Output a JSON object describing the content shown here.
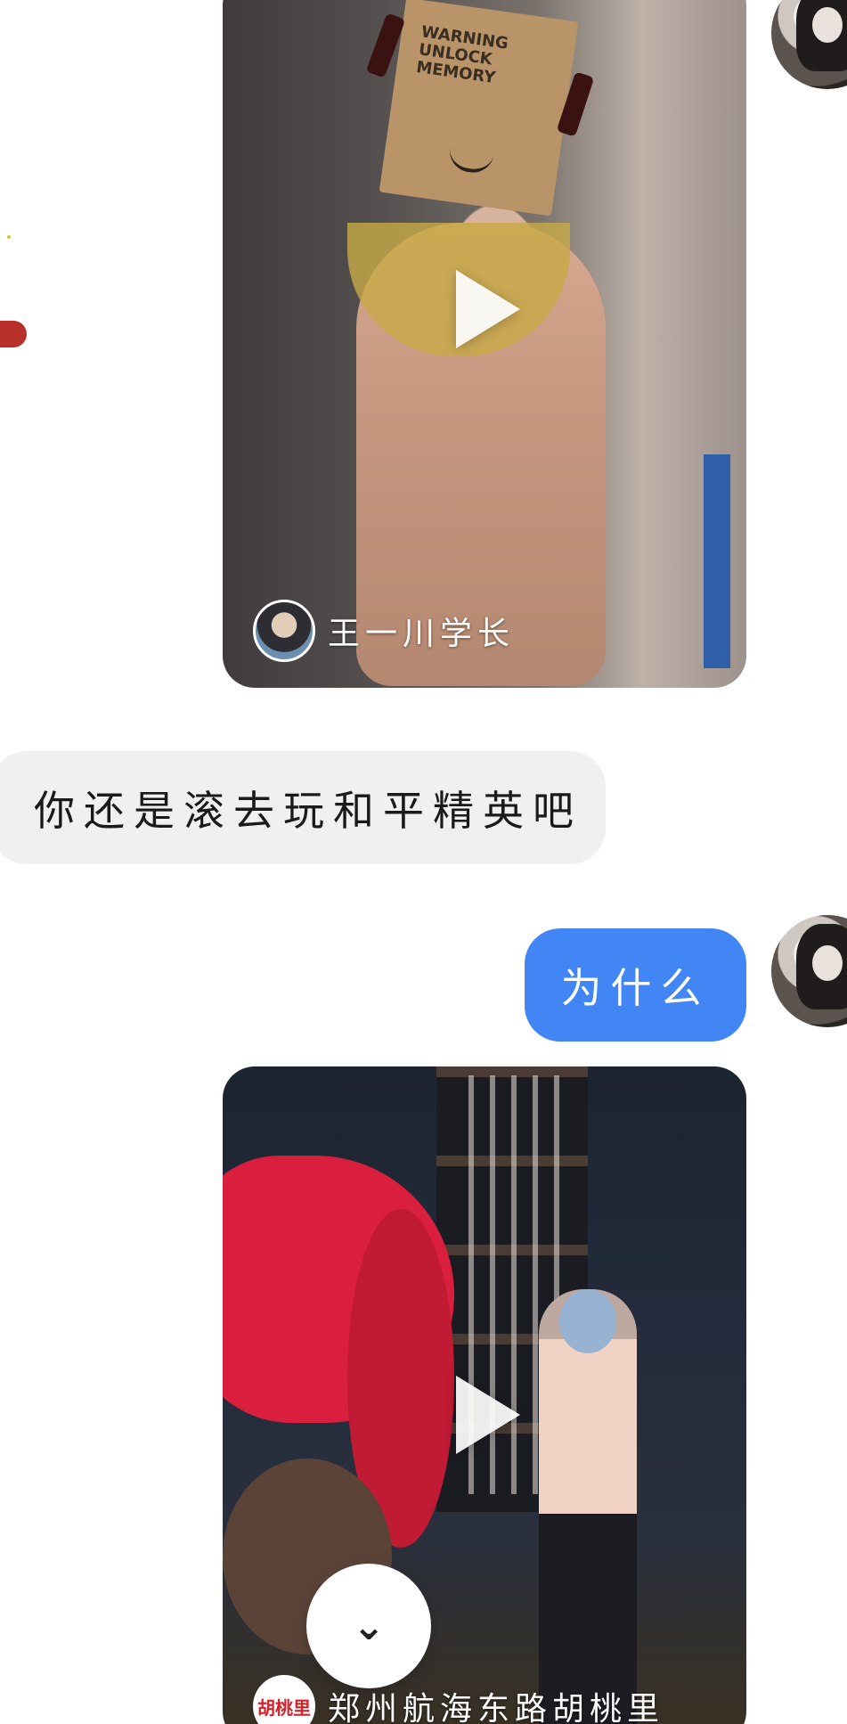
{
  "messages": [
    {
      "type": "video",
      "direction": "outgoing",
      "author_name": "王一川学长",
      "sticker_text": "WARNING\nUNLOCK\nMEMORY"
    },
    {
      "type": "text",
      "direction": "incoming",
      "text": "你还是滚去玩和平精英吧"
    },
    {
      "type": "text",
      "direction": "outgoing",
      "text": "为什么"
    },
    {
      "type": "video",
      "direction": "outgoing",
      "author_name": "郑州航海东路胡桃里",
      "author_logo_text": "胡桃里"
    }
  ],
  "controls": {
    "scroll_bottom_icon": "chevrons-down-icon",
    "scroll_bottom_glyph": "⌄"
  },
  "colors": {
    "outgoing_bubble": "#4286f5",
    "incoming_bubble": "#f0f0f0",
    "background": "#ffffff"
  }
}
